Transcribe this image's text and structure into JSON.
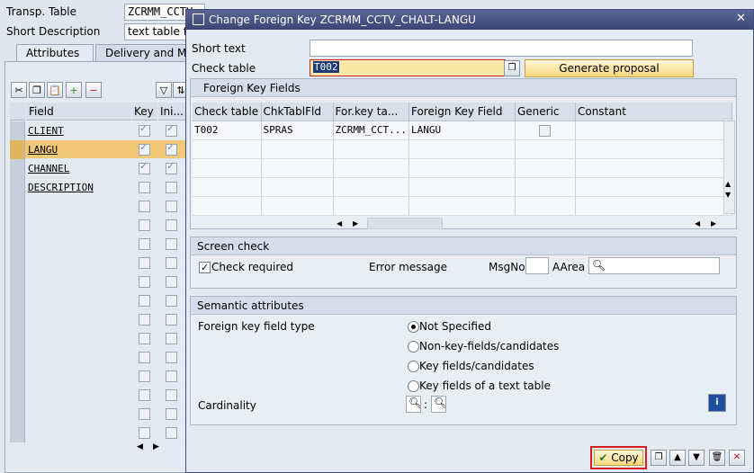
{
  "background": {
    "transp_table_label": "Transp. Table",
    "transp_table_value": "ZCRMM_CCTV_",
    "short_desc_label": "Short Description",
    "short_desc_value": "text table fo",
    "tabs": [
      "Attributes",
      "Delivery and Mai"
    ],
    "columns": [
      "Field",
      "Key",
      "Ini..."
    ],
    "rows": [
      {
        "field": "CLIENT",
        "key": true,
        "init": true,
        "selected": false
      },
      {
        "field": "LANGU",
        "key": true,
        "init": true,
        "selected": true
      },
      {
        "field": "CHANNEL",
        "key": true,
        "init": true,
        "selected": false
      },
      {
        "field": "DESCRIPTION",
        "key": false,
        "init": false,
        "selected": false
      }
    ]
  },
  "dialog": {
    "title": "Change Foreign Key ZCRMM_CCTV_CHALT-LANGU",
    "short_text_label": "Short text",
    "short_text_value": "",
    "check_table_label": "Check table",
    "check_table_value": "T002",
    "generate_proposal_label": "Generate proposal",
    "fk_fields": {
      "heading": "Foreign Key Fields",
      "columns": [
        "Check table",
        "ChkTablFld",
        "For.key ta...",
        "Foreign Key Field",
        "Generic",
        "Constant"
      ],
      "rows": [
        {
          "check_table": "T002",
          "chk_tabl_fld": "SPRAS",
          "for_key_table": "ZCRMM_CCT...",
          "fk_field": "LANGU",
          "generic": false,
          "constant": ""
        }
      ]
    },
    "screen_check": {
      "heading": "Screen check",
      "check_required_label": "Check required",
      "check_required": true,
      "error_message_label": "Error message",
      "msgno_label": "MsgNo",
      "msgno_value": "",
      "aarea_label": "AArea",
      "aarea_value": ""
    },
    "semantic": {
      "heading": "Semantic attributes",
      "fk_field_type_label": "Foreign key field type",
      "options": [
        "Not Specified",
        "Non-key-fields/candidates",
        "Key fields/candidates",
        "Key fields of a text table"
      ],
      "selected_index": 0,
      "cardinality_label": "Cardinality",
      "cardinality_sep": ":"
    },
    "footer": {
      "copy_label": "Copy"
    }
  }
}
